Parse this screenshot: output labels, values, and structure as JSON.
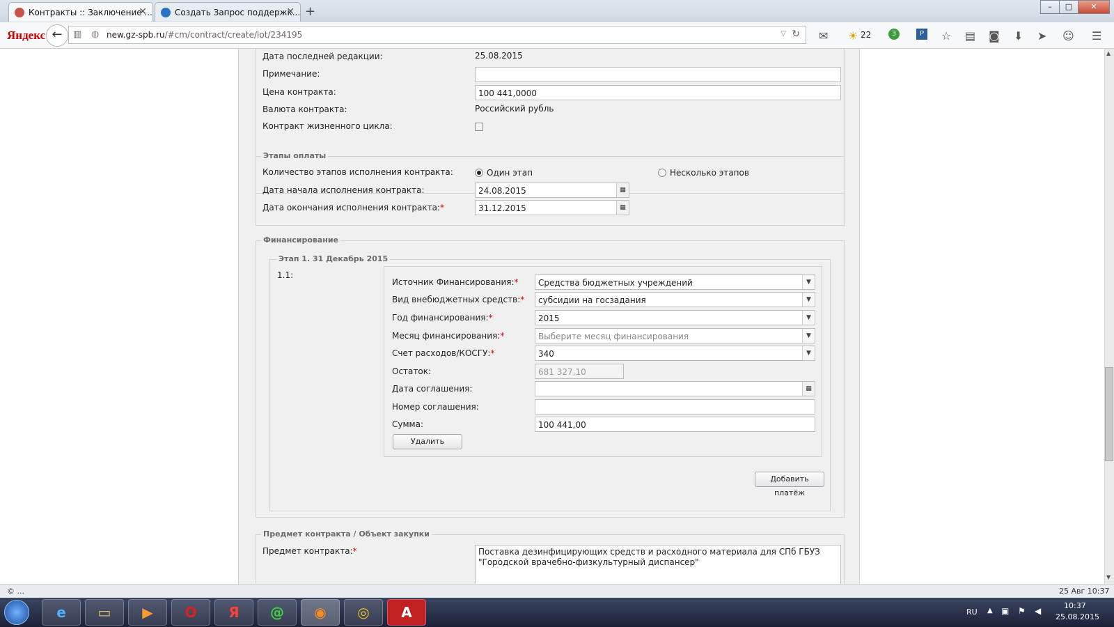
{
  "browser": {
    "tabs": [
      {
        "title": "Контракты :: Заключение ...",
        "active": true
      },
      {
        "title": "Создать Запрос поддержк...",
        "active": false
      }
    ],
    "logo": "Яндекс",
    "url_domain": "new.gz-spb.ru",
    "url_path": "/#cm/contract/create/lot/234195",
    "weather": "22",
    "badge_count": "3",
    "win_controls": [
      "–",
      "□",
      "✕"
    ]
  },
  "top_section": {
    "last_edit_label": "Дата последней редакции:",
    "last_edit_value": "25.08.2015",
    "note_label": "Примечание:",
    "note_value": "",
    "price_label": "Цена контракта:",
    "price_value": "100 441,0000",
    "currency_label": "Валюта контракта:",
    "currency_value": "Российский рубль",
    "lifecycle_label": "Контракт жизненного цикла:",
    "lifecycle_checked": false
  },
  "payment_stages": {
    "legend": "Этапы оплаты",
    "count_label": "Количество этапов исполнения контракта:",
    "option_one": "Один этап",
    "option_many": "Несколько этапов",
    "selected": "one",
    "start_label": "Дата начала исполнения контракта:",
    "start_value": "24.08.2015",
    "end_label": "Дата окончания исполнения контракта:",
    "end_value": "31.12.2015"
  },
  "financing": {
    "legend": "Финансирование",
    "stage_legend": "Этап 1. 31 Декабрь 2015",
    "item_number": "1.1:",
    "source_label": "Источник Финансирования:",
    "source_value": "Средства бюджетных учреждений",
    "extrabudget_label": "Вид внебюджетных средств:",
    "extrabudget_value": "субсидии на госзадания",
    "year_label": "Год финансирования:",
    "year_value": "2015",
    "month_label": "Месяц финансирования:",
    "month_placeholder": "Выберите месяц финансирования",
    "account_label": "Счет расходов/КОСГУ:",
    "account_value": "340",
    "remainder_label": "Остаток:",
    "remainder_value": "681 327,10",
    "agreement_date_label": "Дата соглашения:",
    "agreement_date_value": "",
    "agreement_number_label": "Номер соглашения:",
    "agreement_number_value": "",
    "sum_label": "Сумма:",
    "sum_value": "100 441,00",
    "delete_button": "Удалить",
    "add_payment_button": "Добавить платёж"
  },
  "subject": {
    "legend": "Предмет контракта / Объект закупки",
    "subject_label": "Предмет контракта:",
    "subject_value": "Поставка дезинфицирующих средств и расходного материала для СПб ГБУЗ \"Городской врачебно-физкультурный диспансер\""
  },
  "status_bar": {
    "left_text": "© ...",
    "right_text": "25 Авг 10:37"
  },
  "taskbar": {
    "lang": "RU",
    "time": "10:37",
    "date": "25.08.2015"
  }
}
